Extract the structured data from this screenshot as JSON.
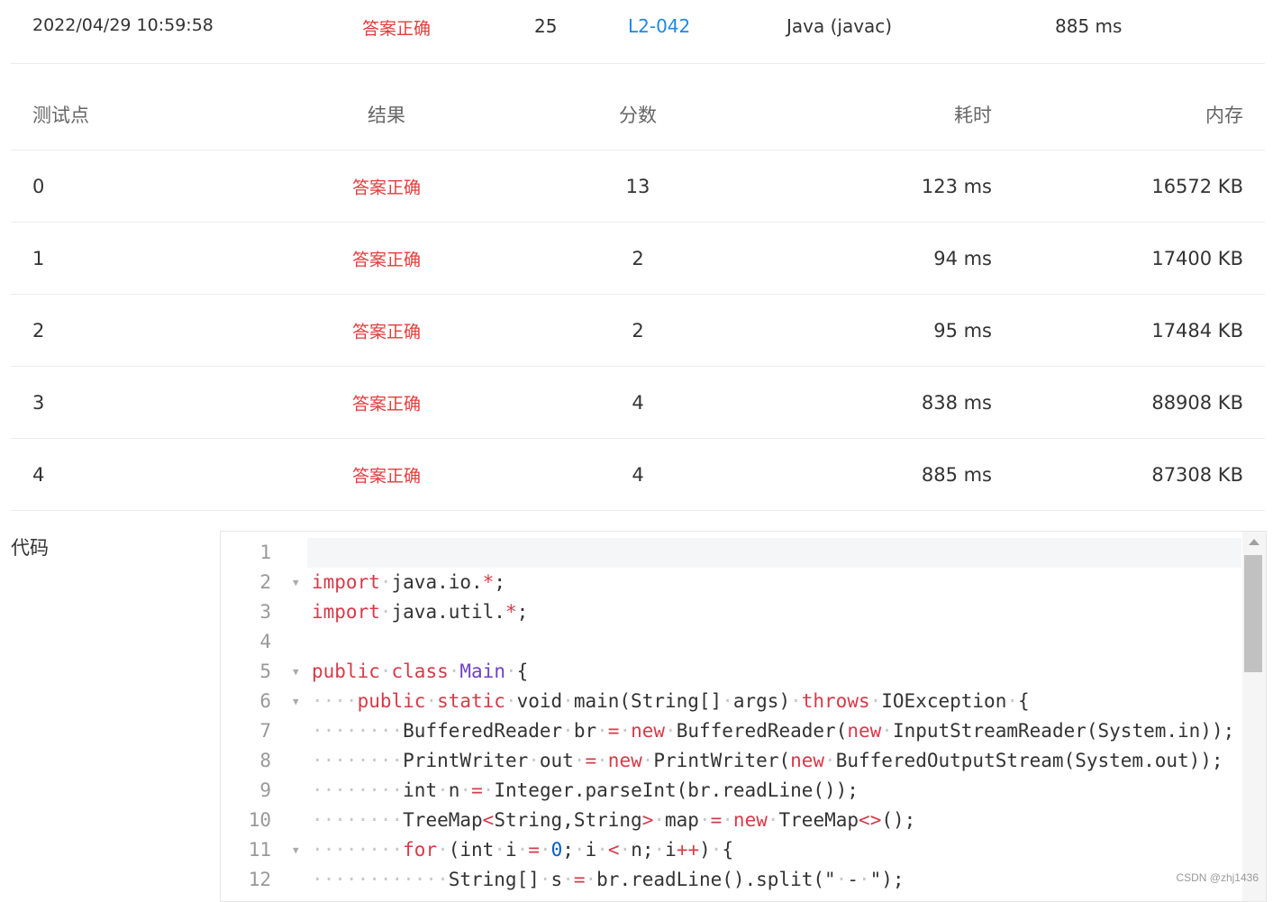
{
  "summary": {
    "submit_time": "2022/04/29 10:59:58",
    "result": "答案正确",
    "score": "25",
    "problem": "L2-042",
    "language": "Java (javac)",
    "time": "885 ms"
  },
  "table": {
    "headers": [
      "测试点",
      "结果",
      "分数",
      "耗时",
      "内存"
    ],
    "rows": [
      [
        "0",
        "答案正确",
        "13",
        "123 ms",
        "16572 KB"
      ],
      [
        "1",
        "答案正确",
        "2",
        "94 ms",
        "17400 KB"
      ],
      [
        "2",
        "答案正确",
        "2",
        "95 ms",
        "17484 KB"
      ],
      [
        "3",
        "答案正确",
        "4",
        "838 ms",
        "88908 KB"
      ],
      [
        "4",
        "答案正确",
        "4",
        "885 ms",
        "87308 KB"
      ]
    ]
  },
  "code_label": "代码",
  "code": {
    "line_numbers": [
      "1",
      "2",
      "3",
      "4",
      "5",
      "6",
      "7",
      "8",
      "9",
      "10",
      "11",
      "12"
    ],
    "lines": [
      "",
      "import java.io.*;",
      "import java.util.*;",
      "",
      "public class Main {",
      "    public static void main(String[] args) throws IOException {",
      "        BufferedReader br = new BufferedReader(new InputStreamReader(System.in));",
      "        PrintWriter out = new PrintWriter(new BufferedOutputStream(System.out));",
      "        int n = Integer.parseInt(br.readLine());",
      "        TreeMap<String,String> map = new TreeMap<>();",
      "        for (int i = 0; i < n; i++) {",
      "            String[] s = br.readLine().split(\" - \");"
    ],
    "foldable_lines": [
      2,
      5,
      6,
      11
    ]
  },
  "watermark": "CSDN @zhj1436",
  "colors": {
    "accent_red": "#e23c3c",
    "link_blue": "#1e88e5",
    "keyword": "#d73a49",
    "class": "#6f42c1",
    "number": "#005cc5"
  }
}
